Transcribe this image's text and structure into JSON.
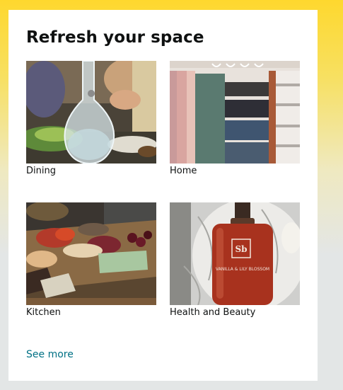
{
  "card": {
    "title": "Refresh your space",
    "tiles": [
      {
        "label": "Dining",
        "image": "dining-table-carafe-photo"
      },
      {
        "label": "Home",
        "image": "hanging-towels-rack-photo"
      },
      {
        "label": "Kitchen",
        "image": "charcuterie-board-photo"
      },
      {
        "label": "Health and Beauty",
        "image": "lotion-bottle-on-marble-photo"
      }
    ],
    "see_more": "See more",
    "beauty_bottle_brand": "Sb",
    "beauty_bottle_text": "VANILLA & LILY BLOSSOM"
  },
  "colors": {
    "background_top": "#fed82e",
    "background_bottom": "#e3e6e6",
    "card": "#ffffff",
    "link": "#007185",
    "text": "#0f1111"
  }
}
